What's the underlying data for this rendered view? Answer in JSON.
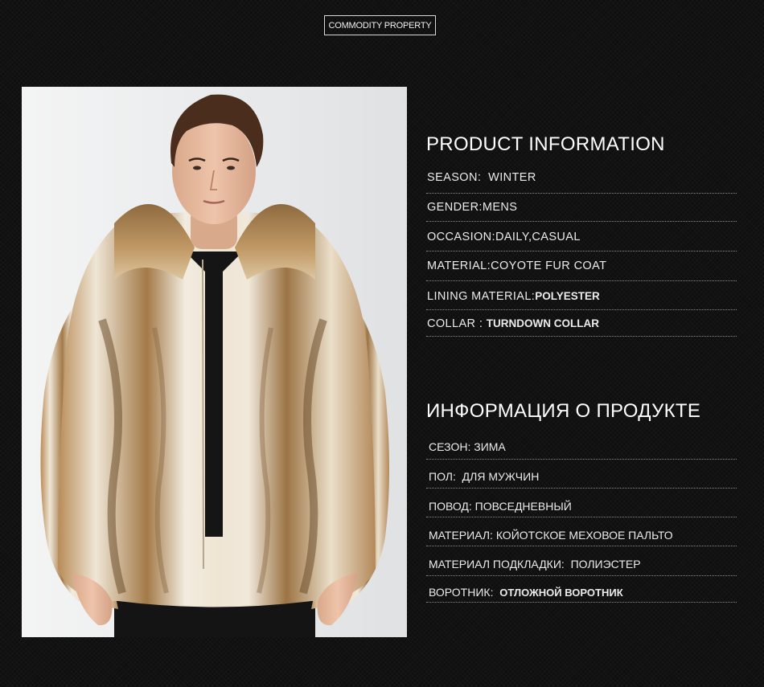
{
  "header": {
    "badge_label": "COMMODITY PROPERTY"
  },
  "product_info_en": {
    "title": "PRODUCT INFORMATION",
    "rows": [
      {
        "label": "SEASON:",
        "value": "WINTER"
      },
      {
        "label": "GENDER:",
        "value": "MENS"
      },
      {
        "label": "OCCASION:",
        "value": "DAILY,CASUAL"
      },
      {
        "label": "MATERIAL:",
        "value": "COYOTE FUR COAT"
      },
      {
        "label": "LINING MATERIAL:",
        "value": "POLYESTER"
      },
      {
        "label": "COLLAR :",
        "value": "TURNDOWN COLLAR"
      }
    ]
  },
  "product_info_ru": {
    "title": "ИНФОРМАЦИЯ О ПРОДУКТЕ",
    "rows": [
      {
        "label": "СЕЗОН:",
        "value": "ЗИМА"
      },
      {
        "label": "ПОЛ:",
        "value": "ДЛЯ МУЖЧИН"
      },
      {
        "label": "ПОВОД:",
        "value": "ПОВСЕДНЕВНЫЙ"
      },
      {
        "label": "МАТЕРИАЛ:",
        "value": "КОЙОТСКОЕ МЕХОВОЕ ПАЛЬТО"
      },
      {
        "label": "МАТЕРИАЛ ПОДКЛАДКИ:",
        "value": "ПОЛИЭСТЕР"
      },
      {
        "label": "ВОРОТНИК:",
        "value": "ОТЛОЖНОЙ ВОРОТНИК"
      }
    ]
  },
  "colors": {
    "background": "#121212",
    "text": "#ebebeb",
    "divider": "#8a8a8a",
    "fur_light": "#efe6d6",
    "fur_tan": "#c9a473",
    "fur_dark": "#7a5b35"
  }
}
